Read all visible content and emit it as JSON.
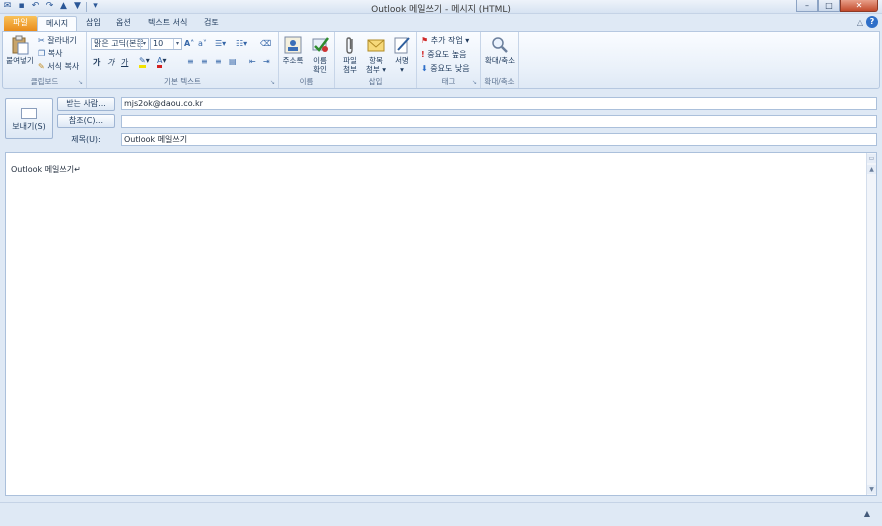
{
  "window": {
    "title": "Outlook 메일쓰기 - 메시지 (HTML)",
    "controls": {
      "minimize": "–",
      "maximize": "□",
      "close": "✕"
    }
  },
  "quick_access": {
    "icons": [
      "save-icon",
      "undo-icon",
      "redo-icon",
      "up-icon",
      "down-icon",
      "customize-icon"
    ]
  },
  "tabs": [
    "파일",
    "메시지",
    "삽입",
    "옵션",
    "텍스트 서식",
    "검토"
  ],
  "active_tab": "메시지",
  "help": {
    "collapse": "△",
    "help_label": "?"
  },
  "ribbon": {
    "clipboard": {
      "paste": "붙여넣기",
      "cut": "잘라내기",
      "copy": "복사",
      "format_painter": "서식 복사",
      "label": "클립보드"
    },
    "basic_text": {
      "font_name": "맑은 고딕(본문",
      "font_size": "10",
      "bold": "가",
      "italic": "가",
      "underline": "가",
      "label": "기본 텍스트"
    },
    "names": {
      "address_book": "주소록",
      "check_names_l1": "이름",
      "check_names_l2": "확인",
      "label": "이름"
    },
    "include": {
      "attach_file_l1": "파일",
      "attach_file_l2": "첨부",
      "attach_item_l1": "항목",
      "attach_item_l2": "첨부 ▾",
      "signature": "서명",
      "label": "삽입"
    },
    "tags": {
      "follow_up": "추가 작업 ▾",
      "high_importance": "중요도 높음",
      "low_importance": "중요도 낮음",
      "label": "태그"
    },
    "zoom": {
      "zoom": "확대/축소",
      "label": "확대/축소"
    }
  },
  "compose": {
    "send": "보내기(S)",
    "to_button": "받는 사람...",
    "cc_button": "참조(C)...",
    "subject_label": "제목(U):",
    "to_value": "mjs2ok@daou.co.kr",
    "cc_value": "",
    "subject_value": "Outlook 메일쓰기",
    "body_text": "Outlook 메일쓰기↵"
  }
}
